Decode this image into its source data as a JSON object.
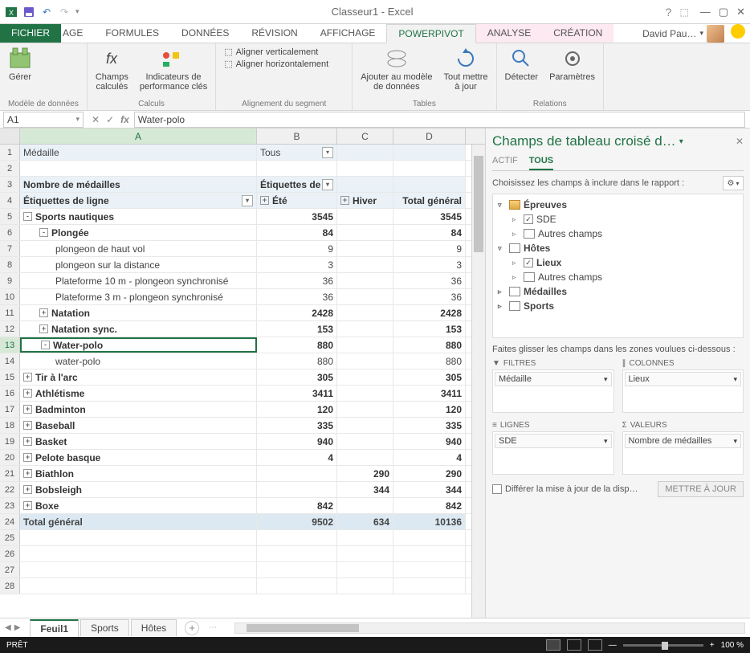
{
  "titlebar": {
    "title": "Classeur1 - Excel",
    "user": "David Pau…"
  },
  "tabs": {
    "fichier": "FICHIER",
    "page": "AGE",
    "formules": "FORMULES",
    "donnees": "DONNÉES",
    "revision": "RÉVISION",
    "affichage": "AFFICHAGE",
    "powerpivot": "POWERPIVOT",
    "analyse": "ANALYSE",
    "creation": "CRÉATION"
  },
  "ribbon": {
    "gerer": "Gérer",
    "champs": "Champs\ncalculés",
    "kpi": "Indicateurs de\nperformance clés",
    "valign": "Aligner verticalement",
    "halign": "Aligner horizontalement",
    "ajouter": "Ajouter au modèle\nde données",
    "refresh": "Tout mettre\nà jour",
    "detecter": "Détecter",
    "params": "Paramètres",
    "g1": "Modèle de données",
    "g2": "Calculs",
    "g3": "Alignement du segment",
    "g4": "Tables",
    "g5": "Relations"
  },
  "namebox": "A1",
  "fxvalue": "Water-polo",
  "cols": {
    "a": "A",
    "b": "B",
    "c": "C",
    "d": "D"
  },
  "rows": [
    {
      "n": 1,
      "a": "Médaille",
      "b": "Tous",
      "bfilter": true,
      "hdr": true
    },
    {
      "n": 2,
      "a": "",
      "b": "",
      "c": "",
      "d": ""
    },
    {
      "n": 3,
      "a": "Nombre de médailles",
      "b": "Étiquettes de",
      "bfilter": true,
      "bold": true,
      "hdr": true
    },
    {
      "n": 4,
      "a": "Étiquettes de ligne",
      "afilter": true,
      "b": "Été",
      "bexp": true,
      "c": "Hiver",
      "cexp": true,
      "d": "Total général",
      "bold": true,
      "hdr": true
    },
    {
      "n": 5,
      "a": "Sports nautiques",
      "exp": "-",
      "b": "3545",
      "d": "3545",
      "bold": true
    },
    {
      "n": 6,
      "a": "Plongée",
      "exp": "-",
      "indent": 1,
      "b": "84",
      "d": "84",
      "bold": true
    },
    {
      "n": 7,
      "a": "plongeon de haut vol",
      "indent": 2,
      "b": "9",
      "d": "9"
    },
    {
      "n": 8,
      "a": "plongeon sur la distance",
      "indent": 2,
      "b": "3",
      "d": "3"
    },
    {
      "n": 9,
      "a": "Plateforme 10 m - plongeon synchronisé",
      "indent": 2,
      "b": "36",
      "d": "36"
    },
    {
      "n": 10,
      "a": "Plateforme 3 m - plongeon synchronisé",
      "indent": 2,
      "b": "36",
      "d": "36"
    },
    {
      "n": 11,
      "a": "Natation",
      "exp": "+",
      "indent": 1,
      "b": "2428",
      "d": "2428",
      "bold": true
    },
    {
      "n": 12,
      "a": "Natation sync.",
      "exp": "+",
      "indent": 1,
      "b": "153",
      "d": "153",
      "bold": true
    },
    {
      "n": 13,
      "a": "Water-polo",
      "exp": "-",
      "indent": 1,
      "b": "880",
      "d": "880",
      "bold": true,
      "sel": true
    },
    {
      "n": 14,
      "a": "water-polo",
      "indent": 2,
      "b": "880",
      "d": "880"
    },
    {
      "n": 15,
      "a": "Tir à l'arc",
      "exp": "+",
      "b": "305",
      "d": "305",
      "bold": true
    },
    {
      "n": 16,
      "a": "Athlétisme",
      "exp": "+",
      "b": "3411",
      "d": "3411",
      "bold": true
    },
    {
      "n": 17,
      "a": "Badminton",
      "exp": "+",
      "b": "120",
      "d": "120",
      "bold": true
    },
    {
      "n": 18,
      "a": "Baseball",
      "exp": "+",
      "b": "335",
      "d": "335",
      "bold": true
    },
    {
      "n": 19,
      "a": "Basket",
      "exp": "+",
      "b": "940",
      "d": "940",
      "bold": true
    },
    {
      "n": 20,
      "a": "Pelote basque",
      "exp": "+",
      "b": "4",
      "d": "4",
      "bold": true
    },
    {
      "n": 21,
      "a": "Biathlon",
      "exp": "+",
      "c": "290",
      "d": "290",
      "bold": true
    },
    {
      "n": 22,
      "a": "Bobsleigh",
      "exp": "+",
      "c": "344",
      "d": "344",
      "bold": true
    },
    {
      "n": 23,
      "a": "Boxe",
      "exp": "+",
      "b": "842",
      "d": "842",
      "bold": true
    },
    {
      "n": 24,
      "a": "Total général",
      "b": "9502",
      "c": "634",
      "d": "10136",
      "total": true
    },
    {
      "n": 25
    },
    {
      "n": 26
    },
    {
      "n": 27
    },
    {
      "n": 28
    }
  ],
  "fieldPane": {
    "title": "Champs de tableau croisé d…",
    "tabActif": "ACTIF",
    "tabTous": "TOUS",
    "instr": "Choisissez les champs à inclure dans le rapport :",
    "tree": [
      {
        "lvl": 1,
        "label": "Épreuves",
        "caret": "▿",
        "icon": "folder"
      },
      {
        "lvl": 2,
        "label": "SDE",
        "caret": "▹",
        "check": true
      },
      {
        "lvl": 2,
        "label": "Autres champs",
        "caret": "▹",
        "icon": "table"
      },
      {
        "lvl": 1,
        "label": "Hôtes",
        "caret": "▿",
        "icon": "table"
      },
      {
        "lvl": 2,
        "label": "Lieux",
        "caret": "▹",
        "check": true,
        "bold": true
      },
      {
        "lvl": 2,
        "label": "Autres champs",
        "caret": "▹",
        "icon": "table"
      },
      {
        "lvl": 1,
        "label": "Médailles",
        "caret": "▹",
        "icon": "table"
      },
      {
        "lvl": 1,
        "label": "Sports",
        "caret": "▹",
        "icon": "table"
      }
    ],
    "dropInstr": "Faites glisser les champs dans les zones voulues ci-dessous :",
    "zFiltres": "FILTRES",
    "zColonnes": "COLONNES",
    "zLignes": "LIGNES",
    "zValeurs": "VALEURS",
    "iFiltres": "Médaille",
    "iColonnes": "Lieux",
    "iLignes": "SDE",
    "iValeurs": "Nombre de médailles",
    "defer": "Différer la mise à jour de la disp…",
    "update": "METTRE À JOUR"
  },
  "sheets": {
    "s1": "Feuil1",
    "s2": "Sports",
    "s3": "Hôtes"
  },
  "status": {
    "ready": "PRÊT",
    "zoom": "100 %"
  }
}
